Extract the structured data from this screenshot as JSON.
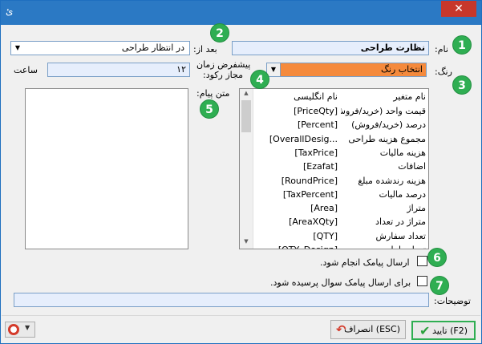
{
  "window": {
    "title": "ﺉ",
    "close_label": "✕"
  },
  "form": {
    "name_label": "نام:",
    "name_value": "نظارت طراحی",
    "after_label": "بعد از:",
    "after_value": "در انتظار طراحی",
    "color_label": "رنگ:",
    "color_value": "انتخاب رنگ",
    "default_time_label_line1": "پیشفرض زمان",
    "default_time_label_line2": "مجاز رکود:",
    "default_time_value": "۱۲",
    "hour_label": "ساعت",
    "message_label": "متن پیام:",
    "description_label": "توضیحات:",
    "description_value": ""
  },
  "variables": {
    "header_fa": "نام متغیر",
    "header_en": "نام انگلیسی",
    "rows": [
      {
        "fa": "قیمت واحد (خرید/فروش)",
        "en": "[PriceQty]"
      },
      {
        "fa": "درصد (خرید/فروش)",
        "en": "[Percent]"
      },
      {
        "fa": "مجموع هزینه طراحی",
        "en": "[OverallDesig..."
      },
      {
        "fa": "هزینه مالیات",
        "en": "[TaxPrice]"
      },
      {
        "fa": "اضافات",
        "en": "[Ezafat]"
      },
      {
        "fa": "هزینه رندشده مبلغ",
        "en": "[RoundPrice]"
      },
      {
        "fa": "درصد مالیات",
        "en": "[TaxPercent]"
      },
      {
        "fa": "متراژ",
        "en": "[Area]"
      },
      {
        "fa": "متراژ در تعداد",
        "en": "[AreaXQty]"
      },
      {
        "fa": "تعداد سفارش",
        "en": "[QTY]"
      },
      {
        "fa": "تعداد طراحی",
        "en": "[QTY_Design]"
      }
    ]
  },
  "options": {
    "send_sms_label": "ارسال پیامک انجام شود.",
    "ask_sms_label": "برای ارسال پیامک سوال پرسیده شود."
  },
  "buttons": {
    "ok_label": "(F2) تایید",
    "cancel_label": "(ESC) انصراف"
  },
  "annotations": [
    "1",
    "2",
    "3",
    "4",
    "5",
    "6",
    "7"
  ],
  "colors": {
    "title_bar": "#2b79c4",
    "color_swatch": "#f58a3c",
    "annotation": "#2fae52",
    "highlight_field": "#e6eefc"
  }
}
